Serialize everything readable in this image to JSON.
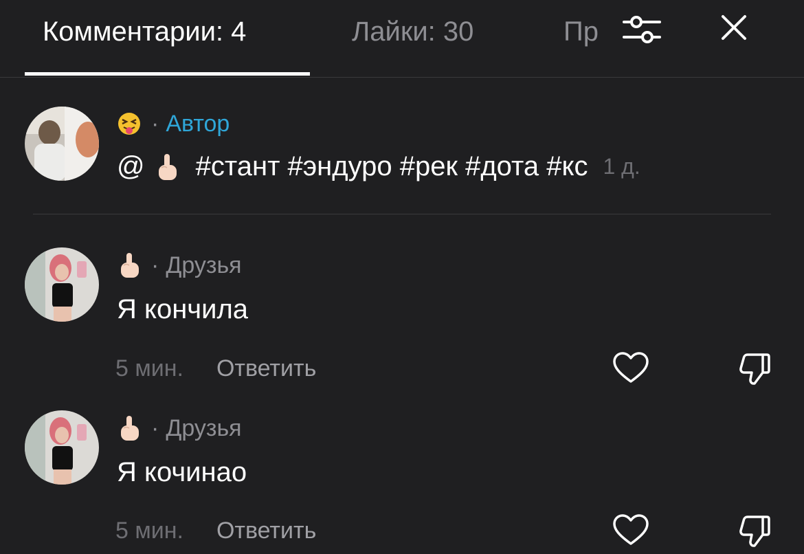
{
  "tabs": {
    "comments_label": "Комментарии: 4",
    "likes_label": "Лайки: 30",
    "third_label": "Пр"
  },
  "icons": {
    "filter": "filter-sliders-icon",
    "close": "close-icon",
    "like": "heart-outline-icon",
    "dislike": "thumbs-down-outline-icon"
  },
  "colors": {
    "background": "#1f1f21",
    "author_accent": "#2fa6d8",
    "muted": "#8e8e93"
  },
  "comments": [
    {
      "emoji": "😝",
      "dot": "·",
      "tag": "Автор",
      "mention": "@",
      "hashtags": "#стант #эндуро #рек #дота #кс",
      "time": "1 д."
    },
    {
      "emoji": "🖕",
      "dot": "·",
      "tag": "Друзья",
      "text": "Я кончила",
      "time": "5 мин.",
      "reply_label": "Ответить"
    },
    {
      "emoji": "🖕",
      "dot": "·",
      "tag": "Друзья",
      "text": "Я кочинао",
      "time": "5 мин.",
      "reply_label": "Ответить"
    }
  ]
}
